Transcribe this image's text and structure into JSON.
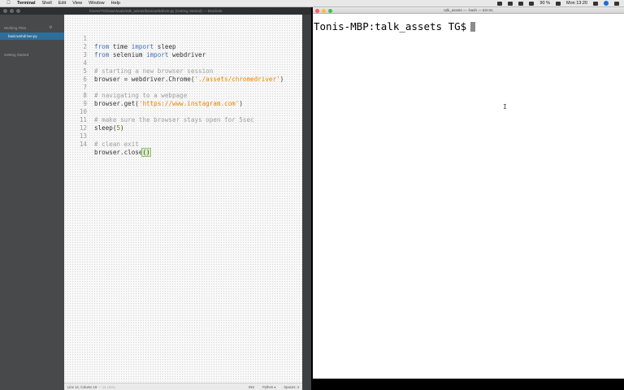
{
  "menubar": {
    "apple": "",
    "app_name": "Terminal",
    "items": [
      "Shell",
      "Edit",
      "View",
      "Window",
      "Help"
    ],
    "battery": "90 %",
    "clock": "Mon 13:20"
  },
  "brackets": {
    "title": "/Users/TG/Downloads/talk_assets/basicwebdriver.py (Getting Started) — Brackets",
    "sidebar": {
      "working_files_header": "Working Files",
      "working_file": "basicwebdriver.py",
      "project_header": "Getting Started"
    },
    "code_lines": [
      {
        "n": "1",
        "text": "from time import sleep"
      },
      {
        "n": "2",
        "text": "from selenium import webdriver"
      },
      {
        "n": "3",
        "text": ""
      },
      {
        "n": "4",
        "text": "# starting a new browser session"
      },
      {
        "n": "5",
        "text": "browser = webdriver.Chrome('./assets/chromedriver')"
      },
      {
        "n": "6",
        "text": ""
      },
      {
        "n": "7",
        "text": "# navigating to a webpage"
      },
      {
        "n": "8",
        "text": "browser.get('https://www.instagram.com')"
      },
      {
        "n": "9",
        "text": ""
      },
      {
        "n": "10",
        "text": "# make sure the browser stays open for 5sec"
      },
      {
        "n": "11",
        "text": "sleep(5)"
      },
      {
        "n": "12",
        "text": ""
      },
      {
        "n": "13",
        "text": "# clean exit"
      },
      {
        "n": "14",
        "text": "browser.close()"
      }
    ],
    "status": {
      "position": "Line 14, Column 16",
      "position_extra": "— 14 Lines",
      "mode": "INS",
      "language": "Python ▾",
      "spaces": "Spaces: 4"
    }
  },
  "terminal": {
    "title": "talk_assets — -bash — 53×31",
    "prompt": "Tonis-MBP:talk_assets TG$",
    "ibeam": "I"
  }
}
